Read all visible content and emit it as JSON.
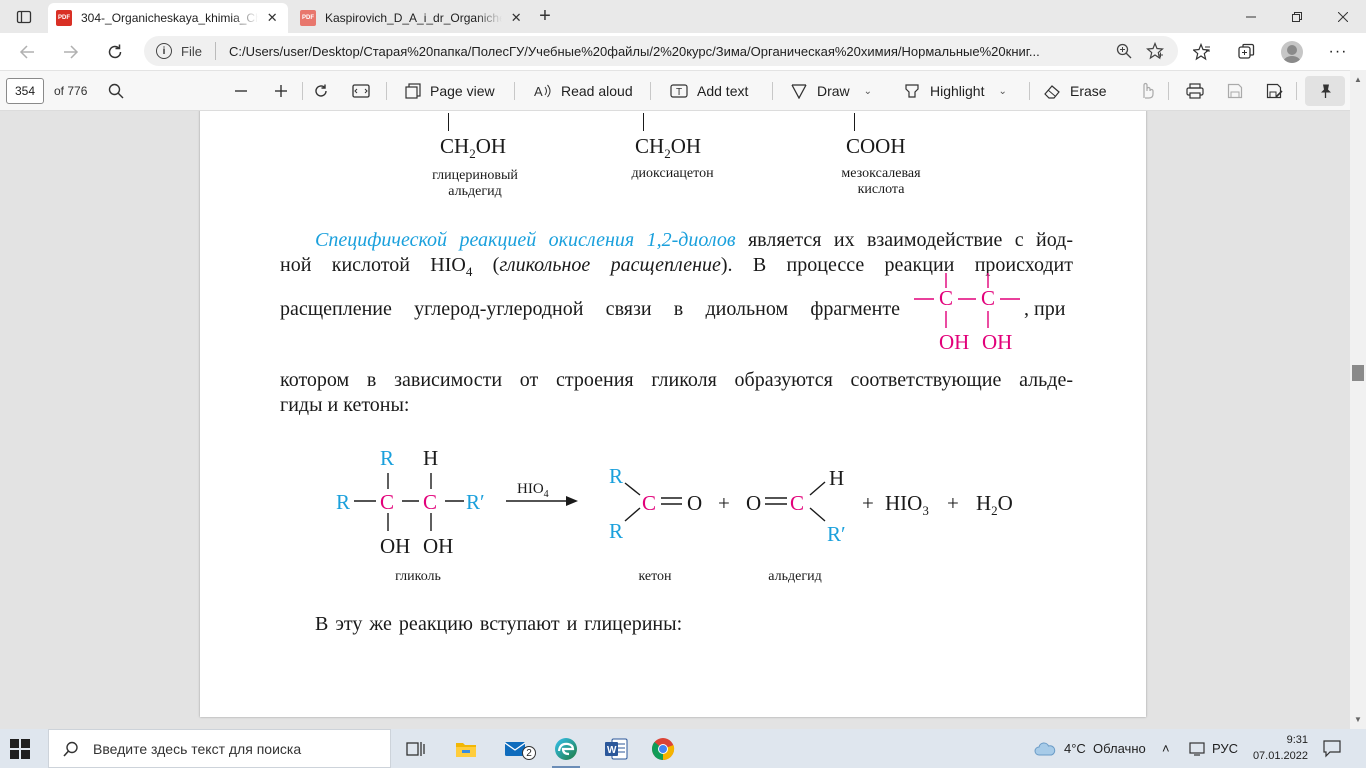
{
  "browser": {
    "tabs": [
      {
        "title": "304-_Organicheskaya_khimia_Ch",
        "favicon": "PDF",
        "active": true
      },
      {
        "title": "Kaspirovich_D_A_i_dr_Organiche",
        "favicon": "PDF",
        "active": false
      }
    ],
    "address": {
      "scheme_label": "File",
      "url": "C:/Users/user/Desktop/Старая%20папка/ПолесГУ/Учебные%20файлы/2%20курс/Зима/Органическая%20химия/Нормальные%20книг..."
    }
  },
  "pdf_toolbar": {
    "page_number": "354",
    "page_count": "of 776",
    "page_view": "Page view",
    "read_aloud": "Read aloud",
    "add_text": "Add text",
    "draw": "Draw",
    "highlight": "Highlight",
    "erase": "Erase"
  },
  "document": {
    "top_formulas": [
      {
        "formula": "CH",
        "sub": "2",
        "rest": "OH",
        "caption": "глицериновый альдегид"
      },
      {
        "formula": "CH",
        "sub": "2",
        "rest": "OH",
        "caption": "диоксиацетон"
      },
      {
        "formula": "COOH",
        "sub": "",
        "rest": "",
        "caption": "мезоксалевая кислота"
      }
    ],
    "p1": {
      "highlight": "Специфической реакцией окисления 1,2-диолов",
      "l1_rest": "является их взаимодействие с йод-",
      "l2_a": "ной кислотой HIO",
      "l2_sub": "4",
      "l2_b": "(",
      "l2_italic": "гликольное расщепление",
      "l2_c": "). В процессе реакции происходит",
      "l3_a": "расщепление углерод-углеродной связи в диольном фрагменте",
      "l3_b": ", при",
      "l4": "котором в зависимости от строения гликоля образуются соответствующие альде-",
      "l5": "гиды и кетоны:"
    },
    "fragment": {
      "c": "C",
      "oh": "OH"
    },
    "reaction": {
      "r": "R",
      "h": "H",
      "c": "C",
      "rp": "R′",
      "oh": "OH",
      "o": "O",
      "reagent": "HIO",
      "reagent_sub": "4",
      "plus": "+",
      "hio3": "HIO",
      "hio3_sub": "3",
      "h2o_a": "H",
      "h2o_sub": "2",
      "h2o_b": "O",
      "caption_glycol": "гликоль",
      "caption_ketone": "кетон",
      "caption_aldehyde": "альдегид"
    },
    "p2": "В эту же реакцию вступают и глицерины:"
  },
  "taskbar": {
    "search_placeholder": "Введите здесь текст для поиска",
    "mail_badge": "2",
    "weather": "4°C  Облачно",
    "language": "РУС",
    "time": "9:31",
    "date": "07.01.2022"
  },
  "colors": {
    "accent_blue": "#1aa0dc",
    "accent_magenta": "#e2007a"
  }
}
